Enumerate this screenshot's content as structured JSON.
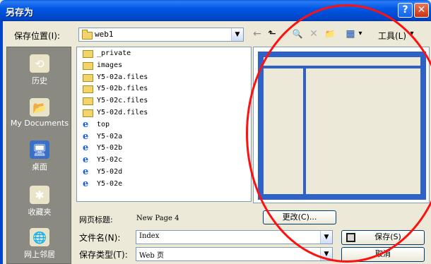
{
  "dialog": {
    "title": "另存为",
    "help_label": "?",
    "close_label": "✕"
  },
  "toolbar": {
    "save_in_label": "保存位置(I):",
    "current_folder": "web1",
    "dropdown_arrow": "▼",
    "back_icon": "←",
    "up_icon": "⬑",
    "search_icon": "🔍",
    "delete_icon": "✕",
    "new_folder_icon": "📁",
    "views_icon": "▦",
    "views_arrow": "▾",
    "tools_label": "工具(L)",
    "tools_arrow": "▾"
  },
  "places": [
    {
      "label": "历史",
      "icon": "history-icon",
      "glyph": "⟲",
      "color": "#e9e4c8"
    },
    {
      "label": "My Documents",
      "icon": "my-documents-icon",
      "glyph": "📂",
      "color": "#e9e4c8"
    },
    {
      "label": "桌面",
      "icon": "desktop-icon",
      "glyph": "🖥",
      "color": "#3b6fc8"
    },
    {
      "label": "收藏夹",
      "icon": "favorites-icon",
      "glyph": "✱",
      "color": "#e9e4c8"
    },
    {
      "label": "网上邻居",
      "icon": "network-icon",
      "glyph": "🌐",
      "color": "#e9e4c8"
    }
  ],
  "files": [
    {
      "name": "_private",
      "type": "folder"
    },
    {
      "name": "images",
      "type": "folder"
    },
    {
      "name": "Y5-02a.files",
      "type": "folder"
    },
    {
      "name": "Y5-02b.files",
      "type": "folder"
    },
    {
      "name": "Y5-02c.files",
      "type": "folder"
    },
    {
      "name": "Y5-02d.files",
      "type": "folder"
    },
    {
      "name": "top",
      "type": "html"
    },
    {
      "name": "Y5-02a",
      "type": "html"
    },
    {
      "name": "Y5-02b",
      "type": "html"
    },
    {
      "name": "Y5-02c",
      "type": "html"
    },
    {
      "name": "Y5-02d",
      "type": "html"
    },
    {
      "name": "Y5-02e",
      "type": "html"
    }
  ],
  "form": {
    "page_title_label": "网页标题:",
    "page_title_value": "New Page 4",
    "change_button": "更改(C)...",
    "filename_label": "文件名(N):",
    "filename_value": "Index",
    "filetype_label": "保存类型(T):",
    "filetype_value": "Web 页",
    "save_button": "保存(S)",
    "cancel_button": "取消"
  },
  "colors": {
    "titlebar": "#0058e6",
    "annotation": "#ff1010",
    "preview_frame": "#2f62c8"
  }
}
